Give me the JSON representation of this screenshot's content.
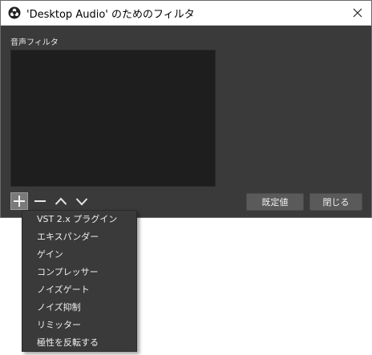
{
  "window": {
    "title": "'Desktop Audio' のためのフィルタ",
    "app_icon": "obs-icon",
    "close_icon": "close-icon"
  },
  "filters": {
    "label": "音声フィルタ",
    "items": []
  },
  "toolbar": {
    "add_icon": "plus-icon",
    "remove_icon": "minus-icon",
    "move_up_icon": "chevron-up-icon",
    "move_down_icon": "chevron-down-icon"
  },
  "buttons": {
    "defaults_label": "既定値",
    "close_label": "閉じる"
  },
  "add_menu": {
    "items": [
      {
        "label": "VST 2.x プラグイン"
      },
      {
        "label": "エキスパンダー"
      },
      {
        "label": "ゲイン"
      },
      {
        "label": "コンプレッサー"
      },
      {
        "label": "ノイズゲート"
      },
      {
        "label": "ノイズ抑制"
      },
      {
        "label": "リミッター"
      },
      {
        "label": "極性を反転する"
      }
    ]
  },
  "colors": {
    "window_bg": "#3a3a3a",
    "list_bg": "#1e1e1e",
    "button_bg": "#5a5a5a",
    "text": "#f0f0f0"
  }
}
